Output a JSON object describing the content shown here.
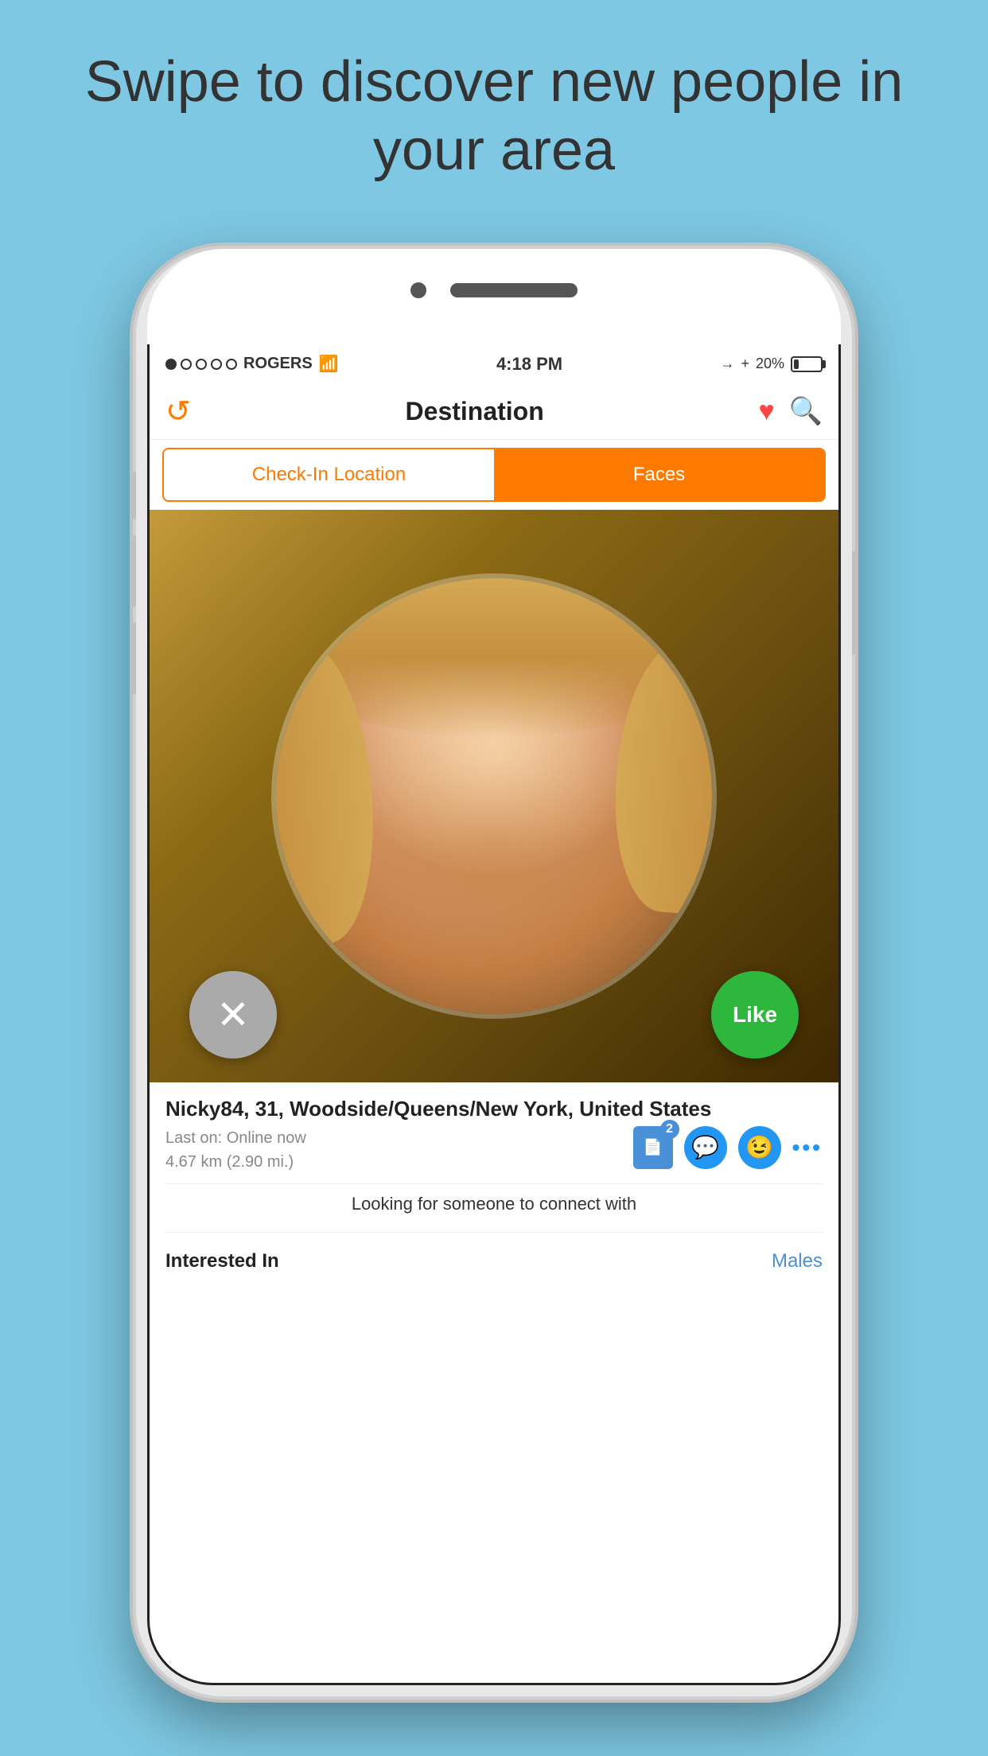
{
  "page": {
    "bg_color": "#7EC8E3",
    "headline": "Swipe to discover new people in your area"
  },
  "status_bar": {
    "carrier": "ROGERS",
    "time": "4:18 PM",
    "battery": "20%",
    "signal_filled": 1,
    "signal_empty": 4
  },
  "nav": {
    "title": "Destination",
    "refresh_label": "↺",
    "heart_label": "♥",
    "search_label": "⌕"
  },
  "tabs": {
    "checkin_label": "Check-In Location",
    "faces_label": "Faces"
  },
  "profile": {
    "name_age_location": "Nicky84, 31, Woodside/Queens/New York, United States",
    "last_on": "Last on: Online now",
    "distance": "4.67 km (2.90 mi.)",
    "badge_count": "2",
    "bio": "Looking for someone to connect with",
    "interested_label": "Interested In",
    "interested_value": "Males"
  },
  "buttons": {
    "discard_label": "✕",
    "like_label": "Like"
  }
}
